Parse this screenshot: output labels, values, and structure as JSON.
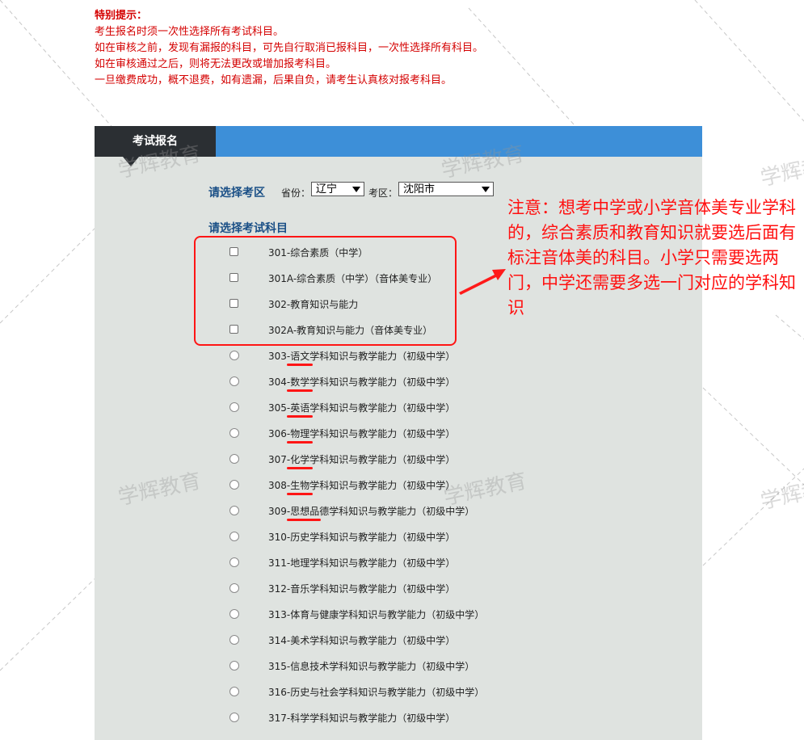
{
  "notice": {
    "title": "特别提示：",
    "lines": [
      "考生报名时须一次性选择所有考试科目。",
      "如在审核之前，发现有漏报的科目，可先自行取消已报科目，一次性选择所有科目。",
      "如在审核通过之后，则将无法更改或增加报考科目。",
      "一旦缴费成功，概不退费，如有遗漏，后果自负，请考生认真核对报考科目。"
    ]
  },
  "tab": {
    "label": "考试报名"
  },
  "area": {
    "title": "请选择考区",
    "province_label": "省份：",
    "province_value": "辽宁",
    "district_label": "考区：",
    "district_value": "沈阳市"
  },
  "subjects": {
    "title": "请选择考试科目",
    "items": [
      "301-综合素质（中学）",
      "301A-综合素质（中学）（音体美专业）",
      "302-教育知识与能力",
      "302A-教育知识与能力（音体美专业）",
      "303-语文学科知识与教学能力（初级中学）",
      "304-数学学科知识与教学能力（初级中学）",
      "305-英语学科知识与教学能力（初级中学）",
      "306-物理学科知识与教学能力（初级中学）",
      "307-化学学科知识与教学能力（初级中学）",
      "308-生物学科知识与教学能力（初级中学）",
      "309-思想品德学科知识与教学能力（初级中学）",
      "310-历史学科知识与教学能力（初级中学）",
      "311-地理学科知识与教学能力（初级中学）",
      "312-音乐学科知识与教学能力（初级中学）",
      "313-体育与健康学科知识与教学能力（初级中学）",
      "314-美术学科知识与教学能力（初级中学）",
      "315-信息技术学科知识与教学能力（初级中学）",
      "316-历史与社会学科知识与教学能力（初级中学）",
      "317-科学学科知识与教学能力（初级中学）"
    ]
  },
  "annotation": {
    "text": "注意：想考中学或小学音体美专业学科的，综合素质和教育知识就要选后面有标注音体美的科目。小学只需要选两门，中学还需要多选一门对应的学科知识",
    "color": "#ff1010"
  },
  "watermark": "学辉教育",
  "colors": {
    "notice": "#d40000",
    "header": "#3d8fd8",
    "tab": "#2b2f33",
    "panel": "#dfe3e0",
    "title": "#1a4f86"
  }
}
